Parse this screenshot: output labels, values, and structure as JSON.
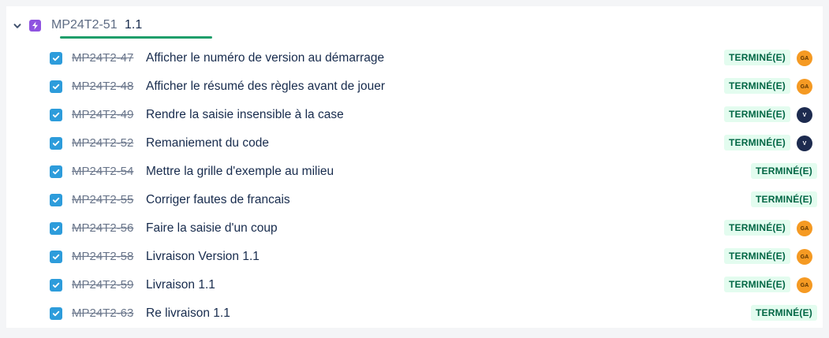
{
  "colors": {
    "epic_icon": "#8f53e0",
    "checkbox": "#2d9cdb",
    "status_bg": "#e3fcef",
    "status_text": "#006644",
    "progress_underline": "#1f9e6a",
    "avatar_ga": "#f59a23",
    "avatar_v": "#1d2b4f"
  },
  "epic": {
    "icon": "lightning-icon",
    "key": "MP24T2-51",
    "version": "1.1"
  },
  "issues": [
    {
      "key": "MP24T2-47",
      "summary": "Afficher le numéro de version au démarrage",
      "status": "TERMINÉ(E)",
      "avatar": "GA"
    },
    {
      "key": "MP24T2-48",
      "summary": "Afficher le résumé des règles avant de jouer",
      "status": "TERMINÉ(E)",
      "avatar": "GA"
    },
    {
      "key": "MP24T2-49",
      "summary": "Rendre la saisie insensible à la case",
      "status": "TERMINÉ(E)",
      "avatar": "V"
    },
    {
      "key": "MP24T2-52",
      "summary": "Remaniement du code",
      "status": "TERMINÉ(E)",
      "avatar": "V"
    },
    {
      "key": "MP24T2-54",
      "summary": "Mettre la grille d'exemple au milieu",
      "status": "TERMINÉ(E)",
      "avatar": ""
    },
    {
      "key": "MP24T2-55",
      "summary": "Corriger fautes de francais",
      "status": "TERMINÉ(E)",
      "avatar": ""
    },
    {
      "key": "MP24T2-56",
      "summary": "Faire la saisie d'un coup",
      "status": "TERMINÉ(E)",
      "avatar": "GA"
    },
    {
      "key": "MP24T2-58",
      "summary": "Livraison Version 1.1",
      "status": "TERMINÉ(E)",
      "avatar": "GA"
    },
    {
      "key": "MP24T2-59",
      "summary": "Livraison 1.1",
      "status": "TERMINÉ(E)",
      "avatar": "GA"
    },
    {
      "key": "MP24T2-63",
      "summary": "Re livraison 1.1",
      "status": "TERMINÉ(E)",
      "avatar": ""
    }
  ]
}
